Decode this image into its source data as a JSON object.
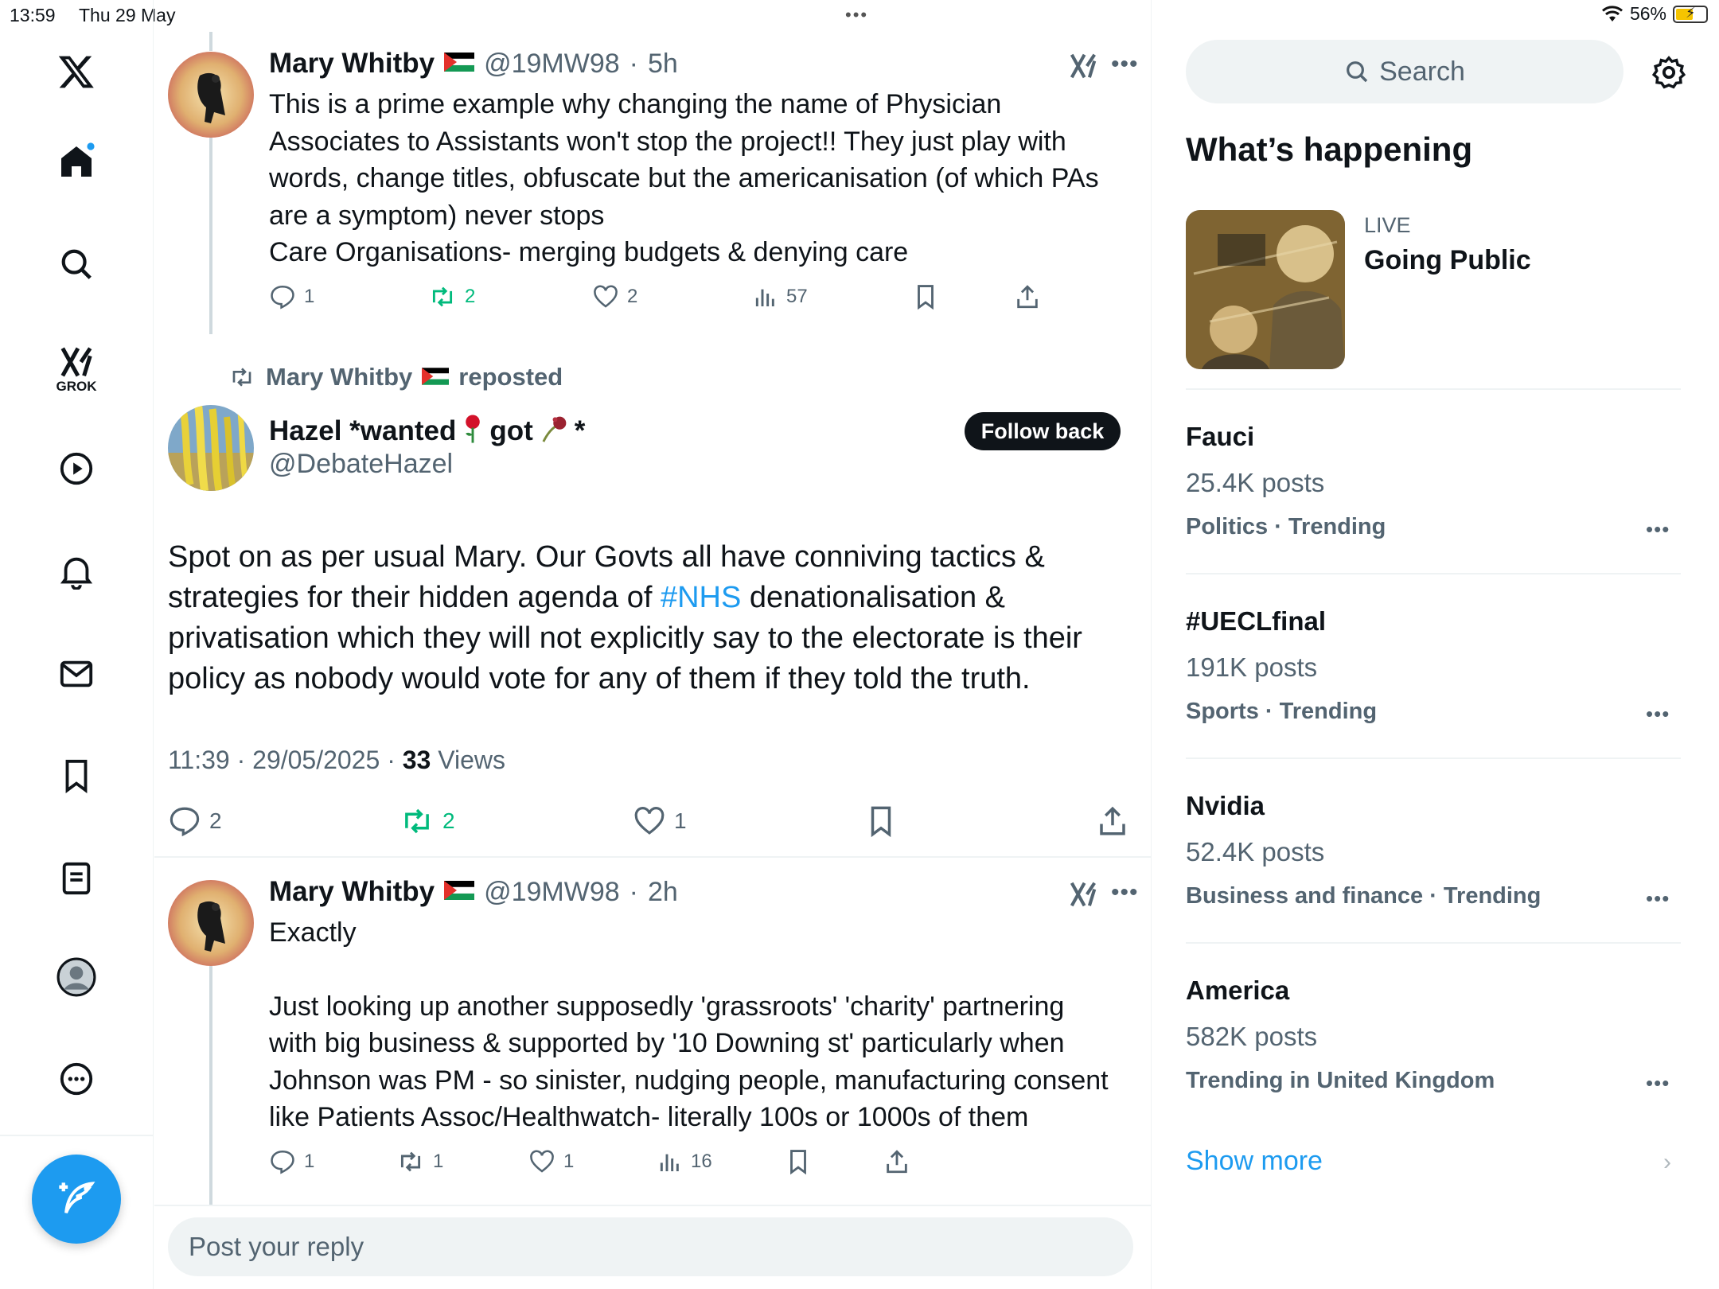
{
  "status": {
    "time": "13:59",
    "date": "Thu 29 May",
    "battery": "56%"
  },
  "nav": {
    "grok_label": "GROK"
  },
  "tweet1": {
    "name": "Mary Whitby",
    "handle": "@19MW98",
    "time": "5h",
    "lines": [
      "This is a prime example why changing the name of Physician",
      "Associates to Assistants won't stop the project!! They just play with",
      "words, change titles, obfuscate but the americanisation (of which PAs",
      "are a symptom) never stops",
      "Care Organisations- merging budgets & denying care"
    ],
    "replies": "1",
    "reposts": "2",
    "likes": "2",
    "views": "57"
  },
  "repost_banner": {
    "name": "Mary Whitby",
    "suffix": "reposted"
  },
  "main_tweet": {
    "name": "Hazel *wanted",
    "name_mid": "got",
    "name_end": "*",
    "handle": "@DebateHazel",
    "follow_label": "Follow back",
    "text_before": "Spot on as per usual Mary.  Our Govts all have conniving tactics & strategies for their hidden agenda of ",
    "hashtag": "#NHS",
    "text_after": " denationalisation & privatisation which they will not explicitly say to the electorate is their policy as nobody would vote for any of them if they told the truth.",
    "timestamp": "11:39 · 29/05/2025 · ",
    "views_count": "33",
    "views_label": "Views",
    "replies": "2",
    "reposts": "2",
    "likes": "1"
  },
  "tweet3": {
    "name": "Mary Whitby",
    "handle": "@19MW98",
    "time": "2h",
    "first_line": "Exactly",
    "lines": [
      "Just looking up another supposedly 'grassroots'  'charity' partnering",
      "with big business & supported by '10 Downing st' particularly when",
      "Johnson was PM - so sinister, nudging people, manufacturing consent",
      "like Patients Assoc/Healthwatch- literally 100s or 1000s of them"
    ],
    "replies": "1",
    "reposts": "1",
    "likes": "1",
    "views": "16"
  },
  "reply_placeholder": "Post your reply",
  "sidebar": {
    "search_placeholder": "Search",
    "section_title": "What’s happening",
    "live": {
      "label": "LIVE",
      "title": "Going Public"
    },
    "trends": [
      {
        "name": "Fauci",
        "count": "25.4K posts",
        "category": "Politics · Trending"
      },
      {
        "name": "#UECLfinal",
        "count": "191K posts",
        "category": "Sports · Trending"
      },
      {
        "name": "Nvidia",
        "count": "52.4K posts",
        "category": "Business and finance · Trending"
      },
      {
        "name": "America",
        "count": "582K posts",
        "category": "Trending in United Kingdom"
      }
    ],
    "show_more": "Show more"
  },
  "colors": {
    "accent": "#1d9bf0",
    "repost_green": "#00ba7c",
    "muted": "#536471"
  }
}
